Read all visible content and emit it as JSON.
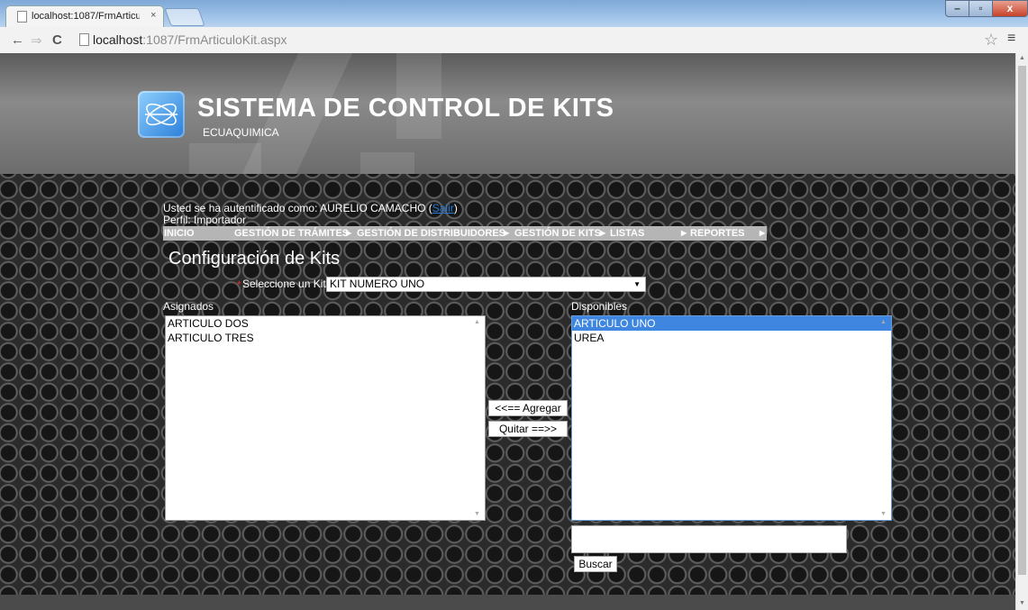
{
  "browser": {
    "tab_title": "localhost:1087/FrmArticul",
    "tab_close": "×",
    "url_host": "localhost",
    "url_rest": ":1087/FrmArticuloKit.aspx",
    "back": "←",
    "forward": "⇒",
    "reload": "C",
    "star": "☆",
    "menu": "≡",
    "min": "–",
    "max": "▫",
    "close": "x"
  },
  "header": {
    "title": "SISTEMA DE CONTROL DE KITS",
    "subtitle": "ECUAQUIMICA"
  },
  "user": {
    "auth_prefix": "Usted se ha autentificado como: AURELIO CAMACHO (",
    "logout_label": "Salir",
    "auth_suffix": ")",
    "perfil": "Perfil: Importador"
  },
  "nav": {
    "items": [
      "INICIO",
      "GESTIÓN DE TRÁMITES",
      "GESTIÓN DE DISTRIBUIDORES",
      "GESTIÓN DE KITS",
      "LISTAS",
      "REPORTES"
    ]
  },
  "form": {
    "page_title": "Configuración de Kits",
    "required_mark": "*",
    "kit_label": "Seleccione un Kit",
    "kit_selected": "KIT NUMERO UNO",
    "asignados_label": "Asignados",
    "disponibles_label": "Disponibles",
    "asignados": [
      "ARTICULO DOS",
      "ARTICULO TRES"
    ],
    "disponibles": [
      "ARTICULO UNO",
      "UREA"
    ],
    "add_button": "<<== Agregar",
    "remove_button": "Quitar ==>>",
    "search_value": "",
    "search_button": "Buscar"
  }
}
